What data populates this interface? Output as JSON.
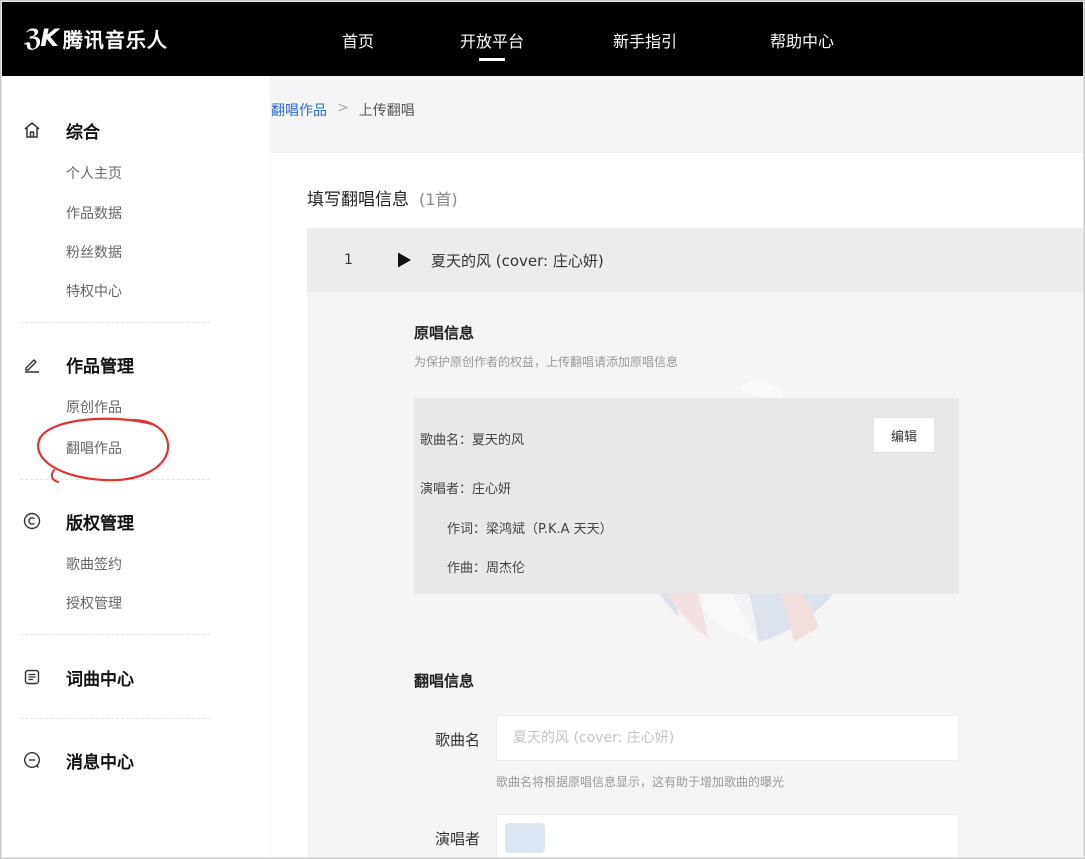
{
  "brand": {
    "mark": "ℨK",
    "name": "腾讯音乐人"
  },
  "nav": [
    {
      "label": "首页"
    },
    {
      "label": "开放平台"
    },
    {
      "label": "新手指引"
    },
    {
      "label": "帮助中心"
    }
  ],
  "sidebar": {
    "sections": [
      {
        "title": "综合",
        "icon": "home-icon",
        "items": [
          "个人主页",
          "作品数据",
          "粉丝数据",
          "特权中心"
        ]
      },
      {
        "title": "作品管理",
        "icon": "pencil-icon",
        "items": [
          "原创作品",
          "翻唱作品"
        ]
      },
      {
        "title": "版权管理",
        "icon": "copyright-icon",
        "items": [
          "歌曲签约",
          "授权管理"
        ]
      },
      {
        "title": "词曲中心",
        "icon": "document-icon",
        "items": []
      },
      {
        "title": "消息中心",
        "icon": "message-icon",
        "items": []
      }
    ],
    "annotation_color": "#e53030"
  },
  "breadcrumb": {
    "link": "翻唱作品",
    "separator": ">",
    "current": "上传翻唱"
  },
  "card": {
    "title": "填写翻唱信息",
    "count": "(1首)",
    "song": {
      "index": "1",
      "name": "夏天的风 (cover: 庄心妍)"
    },
    "original": {
      "title": "原唱信息",
      "note": "为保护原创作者的权益，上传翻唱请添加原唱信息",
      "song_name": "歌曲名：夏天的风",
      "singer": "演唱者：庄心妍",
      "lyricist": "作词：梁鸿斌（P.K.A 天天）",
      "composer": "作曲：周杰伦",
      "edit_label": "编辑"
    },
    "cover": {
      "title": "翻唱信息",
      "song_name_label": "歌曲名",
      "song_name_value": "夏天的风 (cover: 庄心妍)",
      "song_name_hint": "歌曲名将根据原唱信息显示，这有助于增加歌曲的曝光",
      "singer_label": "演唱者"
    }
  },
  "colors": {
    "accent": "#2e6bdd",
    "topbar": "#000000"
  }
}
